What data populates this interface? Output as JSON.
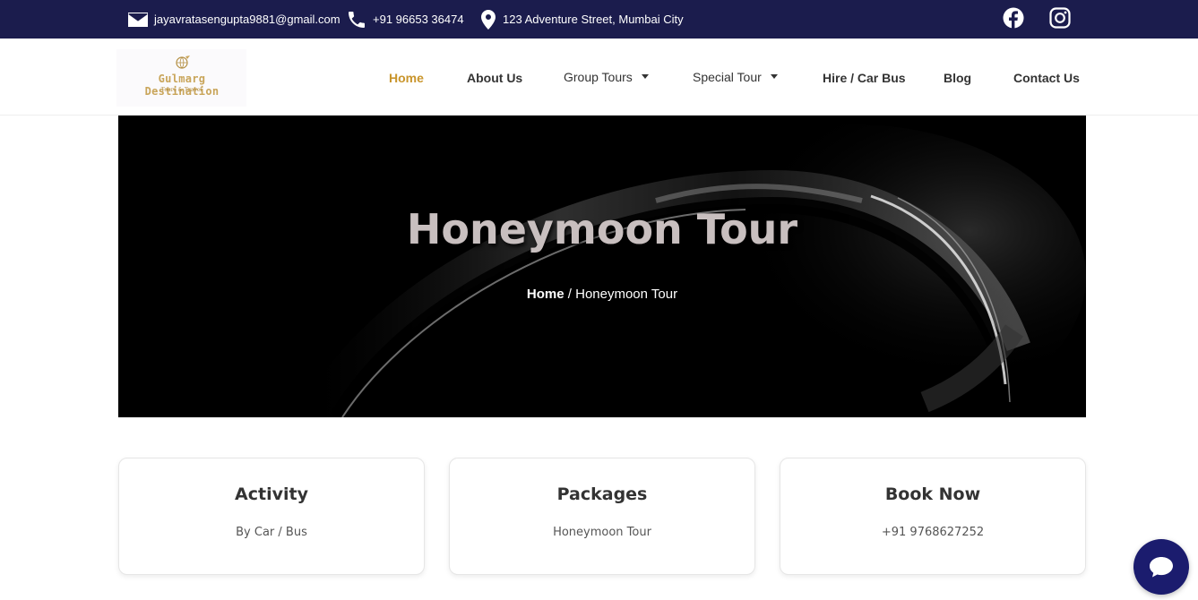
{
  "topbar": {
    "email": "jayavratasengupta9881@gmail.com",
    "phone": "+91 96653 36474",
    "address": "123 Adventure Street, Mumbai City",
    "icons": {
      "email": "envelope-icon",
      "phone": "phone-icon",
      "address": "map-pin-icon",
      "facebook": "facebook-icon",
      "instagram": "instagram-icon"
    },
    "background": "#1b1c4d"
  },
  "logo": {
    "brand": "Gulmarg Destination",
    "tagline": "Tours & Travel"
  },
  "nav": {
    "home": "Home",
    "about": "About Us",
    "group_tours": "Group Tours",
    "special_tour": "Special Tour",
    "hire": "Hire / Car Bus",
    "blog": "Blog",
    "contact": "Contact Us",
    "active_color": "#c9952c"
  },
  "hero": {
    "title": "Honeymoon Tour",
    "breadcrumb_home": "Home",
    "breadcrumb_sep": "/",
    "breadcrumb_current": "Honeymoon Tour"
  },
  "cards": [
    {
      "title": "Activity",
      "subtitle": "By Car / Bus"
    },
    {
      "title": "Packages",
      "subtitle": "Honeymoon Tour"
    },
    {
      "title": "Book Now",
      "subtitle": "+91 9768627252"
    }
  ],
  "chat": {
    "icon": "chat-bubble-icon",
    "color": "#1b1c6e"
  }
}
